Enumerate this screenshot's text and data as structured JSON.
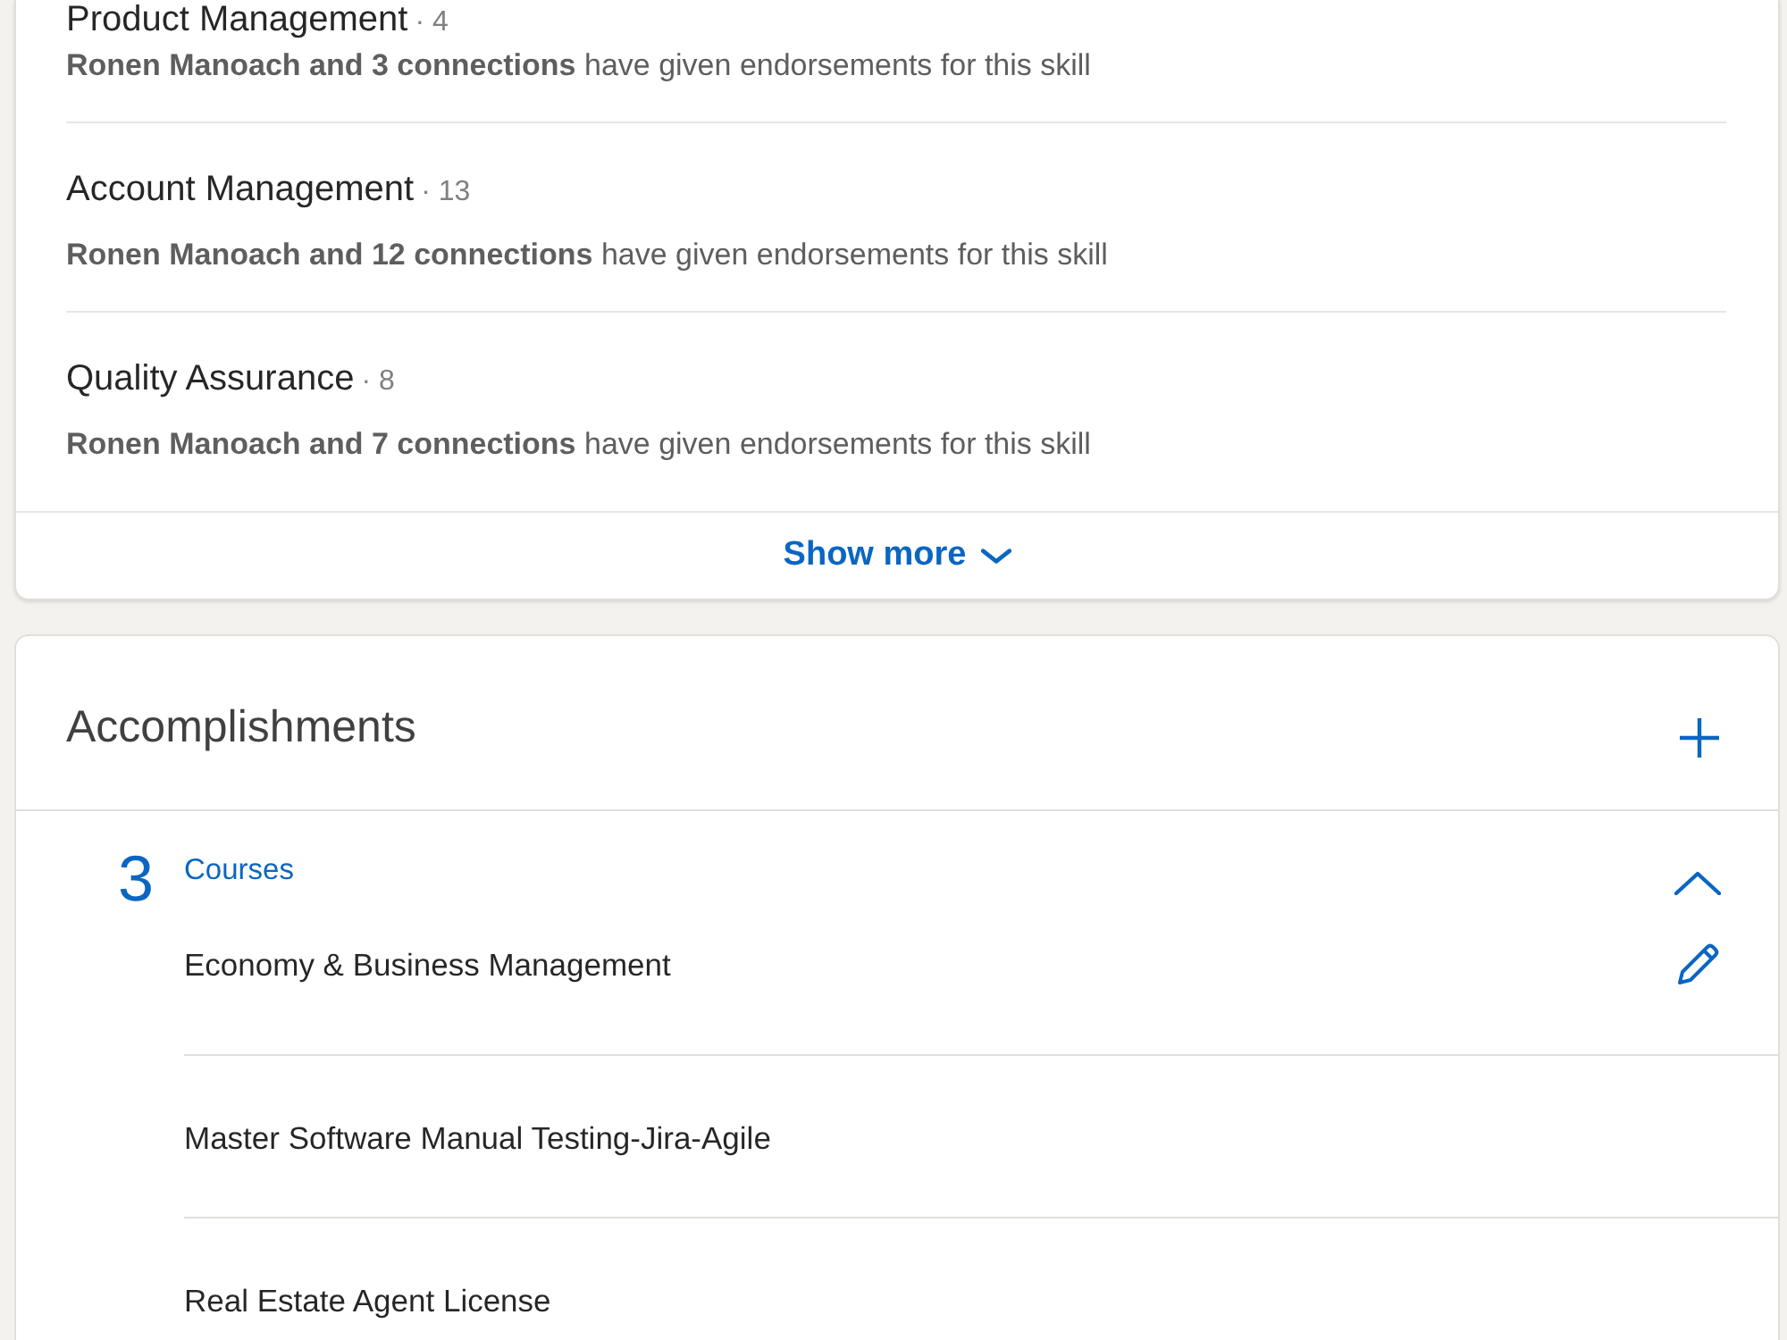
{
  "skills": [
    {
      "name": "Product Management",
      "count": "· 4",
      "endorsement": "**Ronen Manoach and 3 connections** have given endorsements for this skill"
    },
    {
      "name": "Account Management",
      "count": "· 13",
      "endorsement": "**Ronen Manoach and 12 connections** have given endorsements for this skill"
    },
    {
      "name": "Quality Assurance",
      "count": "· 8",
      "endorsement": "**Ronen Manoach and 7 connections** have given endorsements for this skill"
    }
  ],
  "show_more": {
    "label": "Show more"
  },
  "accomplishments": {
    "title": "Accomplishments",
    "sections": [
      {
        "count": "3",
        "label": "Courses",
        "expanded": true,
        "items": [
          {
            "title": "Economy & Business Management"
          },
          {
            "title": "Master Software Manual Testing-Jira-Agile"
          },
          {
            "title": "Real Estate Agent License"
          }
        ]
      }
    ]
  }
}
